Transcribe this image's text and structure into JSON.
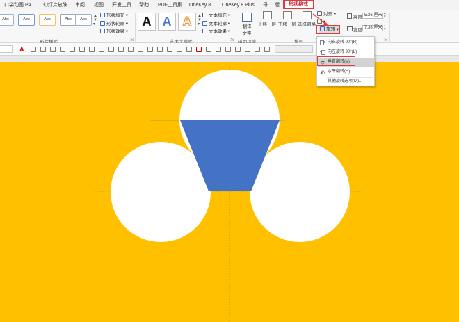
{
  "tabs": [
    "口袋动画 PA",
    "幻灯片放映",
    "审阅",
    "视图",
    "开发工具",
    "帮助",
    "PDF工具集",
    "OneKey 8",
    "OneKey 8 Plus",
    "母",
    "版",
    "形状格式"
  ],
  "ribbon": {
    "shape_styles": {
      "thumb_text": "Abc",
      "fill": "形状填充",
      "outline": "形状轮廓",
      "effects": "形状效果",
      "label": "形状样式"
    },
    "wordart": {
      "letter": "A",
      "text_fill": "文本填充",
      "text_outline": "文本轮廓",
      "text_effects": "文本效果",
      "label": "艺术字样式"
    },
    "accessibility": {
      "translate_line1": "翻译",
      "translate_line2": "文字",
      "label": "辅助功能"
    },
    "arrange": {
      "align": "对齐",
      "bring_forward": "上移一层",
      "send_backward": "下移一层",
      "selection_pane": "选择窗格",
      "rotate": "旋转",
      "label": "排列"
    },
    "size": {
      "height_label": "高度:",
      "height_value": "5.26 厘米",
      "width_label": "宽度:",
      "width_value": "7.38 厘米"
    }
  },
  "rotate_menu": {
    "items": [
      {
        "label": "向右旋转 90°(R)"
      },
      {
        "label": "向左旋转 90°(L)"
      },
      {
        "label": "垂直翻转(V)"
      },
      {
        "label": "水平翻转(H)"
      },
      {
        "label": "其他旋转选项(M)..."
      }
    ],
    "selected_index": 2
  },
  "colors": {
    "canvas": "#ffc000",
    "trapezoid": "#4472c4",
    "circle": "#ffffff",
    "highlight": "#e23b3b"
  }
}
